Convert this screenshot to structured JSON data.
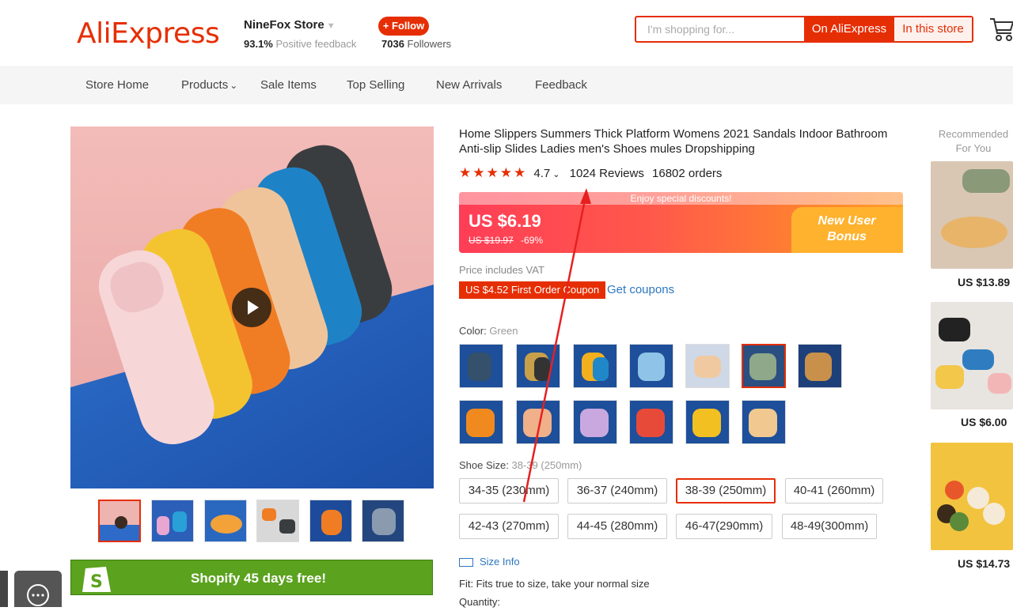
{
  "header": {
    "logo": "AliExpress",
    "store_name": "NineFox Store",
    "positive_pct": "93.1%",
    "positive_label": "Positive feedback",
    "follow_label": "+ Follow",
    "followers_count": "7036",
    "followers_label": "Followers",
    "search_placeholder": "I'm shopping for...",
    "btn_on_aliexpress": "On AliExpress",
    "btn_in_store": "In this store"
  },
  "nav": {
    "items": [
      "Store Home",
      "Products",
      "Sale Items",
      "Top Selling",
      "New Arrivals",
      "Feedback"
    ]
  },
  "gallery": {
    "shopify_banner": "Shopify 45 days free!"
  },
  "product": {
    "title": "Home Slippers Summers Thick Platform Womens 2021 Sandals Indoor Bathroom Anti-slip Slides Ladies men's Shoes mules Dropshipping",
    "stars": "★★★★★",
    "rating": "4.7",
    "reviews": "1024 Reviews",
    "orders": "16802 orders",
    "promo_banner": "Enjoy special discounts!",
    "price": "US $6.19",
    "old_price": "US $19.97",
    "discount": "-69%",
    "bonus_line1": "New User",
    "bonus_line2": "Bonus",
    "vat_note": "Price includes VAT",
    "coupon": "US $4.52 First Order Coupon",
    "get_coupons": "Get coupons",
    "color_label": "Color:",
    "color_value": "Green",
    "size_label": "Shoe Size:",
    "size_value": "38-39 (250mm)",
    "sizes": [
      "34-35 (230mm)",
      "36-37 (240mm)",
      "38-39 (250mm)",
      "40-41 (260mm)",
      "42-43 (270mm)",
      "44-45 (280mm)",
      "46-47(290mm)",
      "48-49(300mm)"
    ],
    "size_info": "Size Info",
    "fit": "Fit: Fits true to size, take your normal size",
    "quantity_label": "Quantity:"
  },
  "recommended": {
    "title": "Recommended For You",
    "prices": [
      "US $13.89",
      "US $6.00",
      "US $14.73"
    ]
  },
  "colors": {
    "accent": "#e62e04",
    "link": "#2d77c1",
    "shopify": "#5ba21e"
  }
}
